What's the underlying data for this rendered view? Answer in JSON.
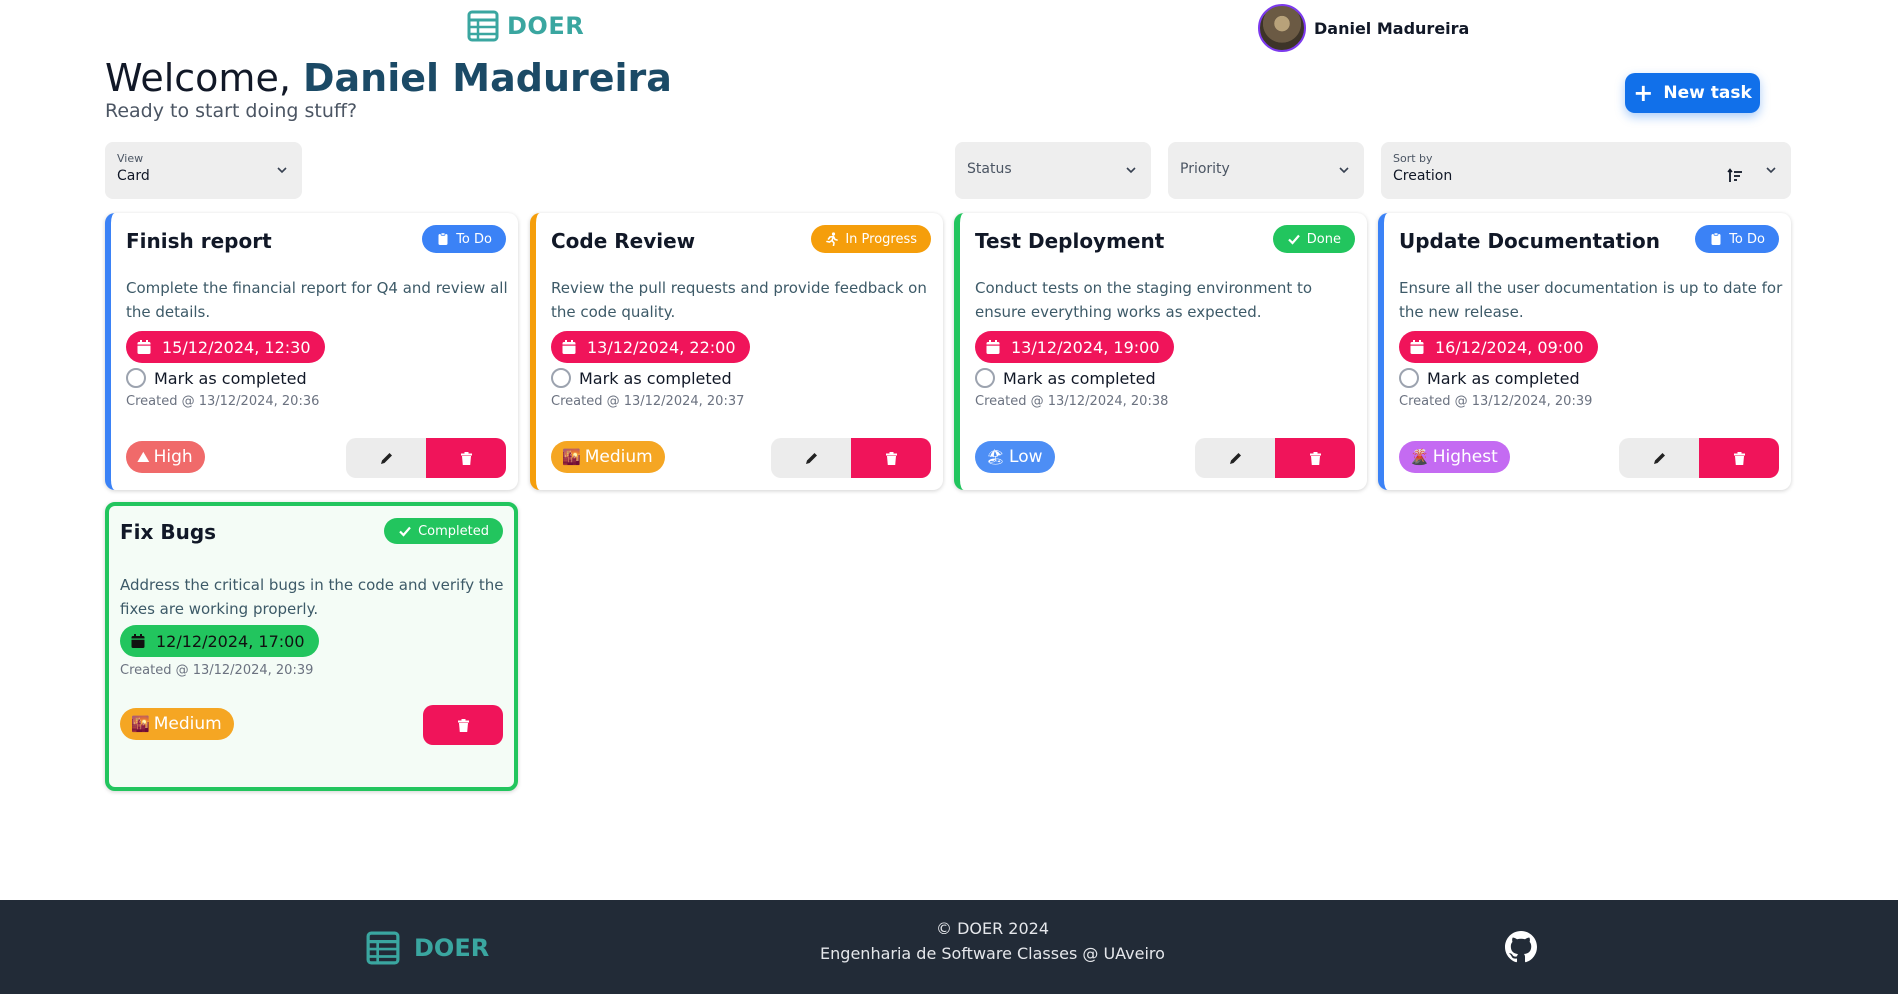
{
  "header": {
    "brand": "DOER",
    "user_name": "Daniel Madureira"
  },
  "welcome": {
    "greeting": "Welcome,",
    "name": "Daniel Madureira",
    "subtitle": "Ready to start doing stuff?"
  },
  "new_task_label": "New task",
  "filters": {
    "view": {
      "label": "View",
      "value": "Card"
    },
    "status": {
      "placeholder": "Status"
    },
    "priority": {
      "placeholder": "Priority"
    },
    "sort": {
      "label": "Sort by",
      "value": "Creation"
    }
  },
  "mark_label": "Mark as completed",
  "tasks": [
    {
      "title": "Finish report",
      "status": "To Do",
      "description": "Complete the financial report for Q4 and review all the details.",
      "due": "15/12/2024, 12:30",
      "created": "Created @ 13/12/2024, 20:36",
      "priority": "High",
      "priority_icon": "mountain-icon"
    },
    {
      "title": "Code Review",
      "status": "In Progress",
      "description": "Review the pull requests and provide feedback on the code quality.",
      "due": "13/12/2024, 22:00",
      "created": "Created @ 13/12/2024, 20:37",
      "priority": "Medium",
      "priority_icon": "sunset-icon"
    },
    {
      "title": "Test Deployment",
      "status": "Done",
      "description": "Conduct tests on the staging environment to ensure everything works as expected.",
      "due": "13/12/2024, 19:00",
      "created": "Created @ 13/12/2024, 20:38",
      "priority": "Low",
      "priority_icon": "beach-icon"
    },
    {
      "title": "Update Documentation",
      "status": "To Do",
      "description": "Ensure all the user documentation is up to date for the new release.",
      "due": "16/12/2024, 09:00",
      "created": "Created @ 13/12/2024, 20:39",
      "priority": "Highest",
      "priority_icon": "volcano-icon"
    },
    {
      "title": "Fix Bugs",
      "status": "Completed",
      "description": "Address the critical bugs in the code and verify the fixes are working properly.",
      "due": "12/12/2024, 17:00",
      "created": "Created @ 13/12/2024, 20:39",
      "priority": "Medium",
      "priority_icon": "sunset-icon"
    }
  ],
  "footer": {
    "brand": "DOER",
    "copyright": "© DOER 2024",
    "credits": "Engenharia de Software Classes @ UAveiro"
  },
  "colors": {
    "brand": "#3aa6a0",
    "todo": "#3b82f6",
    "in_progress": "#f59e0b",
    "done": "#22c55e",
    "danger": "#f0145a",
    "primary_button": "#1170ea"
  }
}
